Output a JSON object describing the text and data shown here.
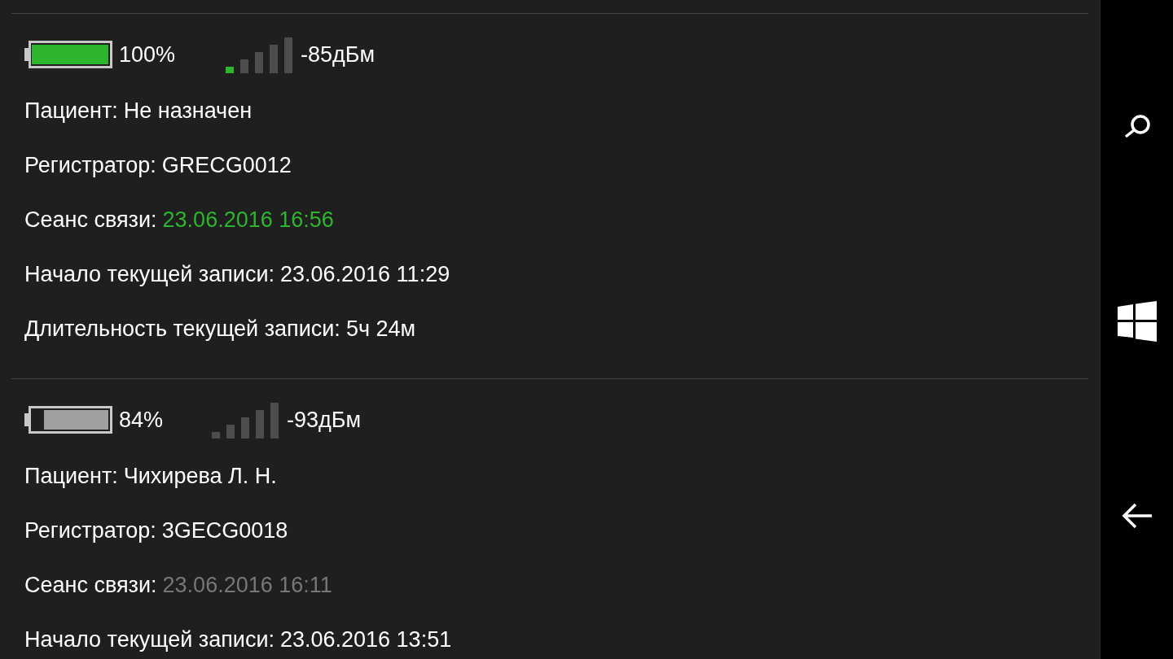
{
  "devices": [
    {
      "online": true,
      "battery": {
        "level": 1,
        "reading": "100%"
      },
      "signal": {
        "bars": [
          {
            "lit": true
          },
          {
            "lit": false
          },
          {
            "lit": false
          },
          {
            "lit": false
          },
          {
            "lit": false
          }
        ],
        "reading": "-85дБм"
      },
      "lines": [
        {
          "label": "Пациент:",
          "value": "Не назначен"
        },
        {
          "label": "Регистратор:",
          "value": "GRECG0012"
        },
        {
          "label": "Сеанс связи:",
          "value": "23.06.2016 16:56",
          "kind": "session"
        },
        {
          "label": "Начало текущей записи:",
          "value": "23.06.2016 11:29"
        },
        {
          "label": "Длительность текущей записи:",
          "value": "5ч 24м"
        }
      ]
    },
    {
      "online": false,
      "battery": {
        "level": 0.84,
        "reading": "84%"
      },
      "signal": {
        "bars": [
          {
            "lit": false
          },
          {
            "lit": false
          },
          {
            "lit": false
          },
          {
            "lit": false
          },
          {
            "lit": false
          }
        ],
        "reading": "-93дБм"
      },
      "lines": [
        {
          "label": "Пациент:",
          "value": "Чихирева Л. Н."
        },
        {
          "label": "Регистратор:",
          "value": "3GECG0018"
        },
        {
          "label": "Сеанс связи:",
          "value": "23.06.2016 16:11",
          "kind": "session"
        },
        {
          "label": "Начало текущей записи:",
          "value": "23.06.2016 13:51"
        }
      ]
    }
  ]
}
